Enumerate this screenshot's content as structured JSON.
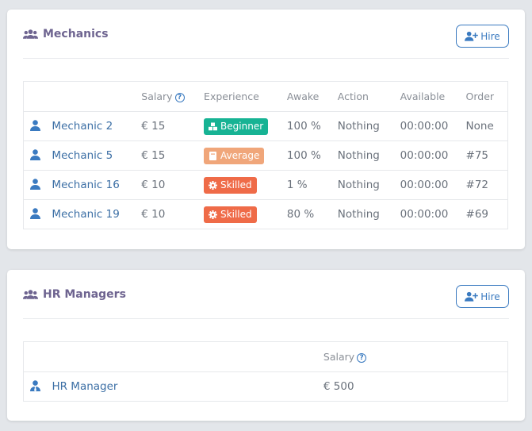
{
  "mechanics": {
    "title": "Mechanics",
    "hire_label": "Hire",
    "columns": {
      "name": "",
      "salary": "Salary",
      "experience": "Experience",
      "awake": "Awake",
      "action": "Action",
      "available": "Available",
      "order": "Order"
    },
    "rows": [
      {
        "name": "Mechanic 2",
        "salary": "€ 15",
        "experience": "Beginner",
        "awake": "100 %",
        "action": "Nothing",
        "available": "00:00:00",
        "order": "None"
      },
      {
        "name": "Mechanic 5",
        "salary": "€ 15",
        "experience": "Average",
        "awake": "100 %",
        "action": "Nothing",
        "available": "00:00:00",
        "order": "#75"
      },
      {
        "name": "Mechanic 16",
        "salary": "€ 10",
        "experience": "Skilled",
        "awake": "1 %",
        "action": "Nothing",
        "available": "00:00:00",
        "order": "#72"
      },
      {
        "name": "Mechanic 19",
        "salary": "€ 10",
        "experience": "Skilled",
        "awake": "80 %",
        "action": "Nothing",
        "available": "00:00:00",
        "order": "#69"
      }
    ]
  },
  "hr_managers": {
    "title": "HR Managers",
    "hire_label": "Hire",
    "columns": {
      "name": "",
      "salary": "Salary"
    },
    "rows": [
      {
        "name": "HR Manager",
        "salary": "€ 500"
      }
    ]
  },
  "icons": {
    "section": "users-icon",
    "hire": "user-plus-icon",
    "help": "question-circle-icon",
    "mechanic": "user-icon",
    "hr": "user-tie-icon",
    "beginner": "cubes-icon",
    "average": "book-icon",
    "skilled": "cog-icon"
  },
  "colors": {
    "accent": "#3a7ac0",
    "title": "#6e6490",
    "beginner": "#17b394",
    "average": "#f0a67a",
    "skilled": "#ef6b48",
    "background": "#e3e6ea"
  }
}
